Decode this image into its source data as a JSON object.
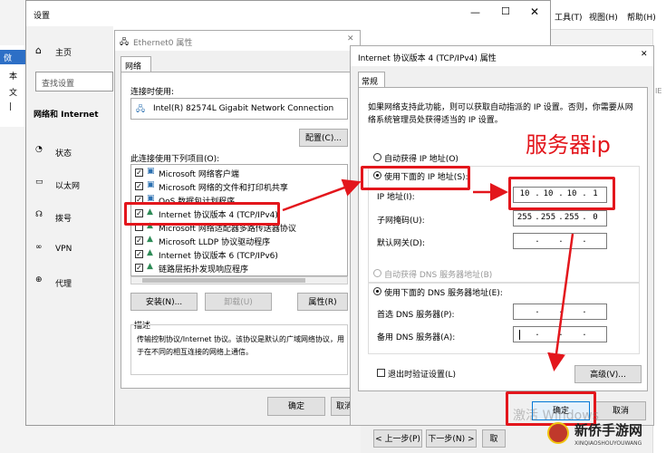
{
  "settings": {
    "title": "设置",
    "home": "主页",
    "search_placeholder": "查找设置",
    "section": "网络和 Internet",
    "items": [
      "状态",
      "以太网",
      "拨号",
      "VPN",
      "代理"
    ]
  },
  "explorer": {
    "menu_tools": "工具(T)",
    "menu_view": "视图(H)",
    "menu_help": "帮助(H)",
    "left_cut": "傚",
    "left_labels": [
      "本",
      "文",
      "|"
    ]
  },
  "eth": {
    "title": "Ethernet0 属性",
    "tab": "网络",
    "connect_using": "连接时使用:",
    "adapter": "Intel(R) 82574L Gigabit Network Connection",
    "config_button": "配置(C)...",
    "items_label": "此连接使用下列项目(O):",
    "items": [
      "Microsoft 网络客户端",
      "Microsoft 网络的文件和打印机共享",
      "QoS 数据包计划程序",
      "Internet 协议版本 4 (TCP/IPv4)",
      "Microsoft 网络适配器多路传送器协议",
      "Microsoft LLDP 协议驱动程序",
      "Internet 协议版本 6 (TCP/IPv6)",
      "链路层拓扑发现响应程序"
    ],
    "install": "安装(N)...",
    "uninstall": "卸载(U)",
    "properties": "属性(R)",
    "desc_label": "描述",
    "description_line1": "传输控制协议/Internet 协议。该协议是默认的广域网络协议，用",
    "description_line2": "于在不同的相互连接的网络上通信。",
    "ok": "确定",
    "cancel": "取消"
  },
  "ipv4": {
    "title": "Internet 协议版本 4 (TCP/IPv4) 属性",
    "tab": "常规",
    "info_line1": "如果网络支持此功能，则可以获取自动指派的 IP 设置。否则，你需要从网",
    "info_line2": "络系统管理员处获得适当的 IP 设置。",
    "auto_ip": "自动获得 IP 地址(O)",
    "manual_ip": "使用下面的 IP 地址(S):",
    "ip_label": "IP 地址(I):",
    "ip": [
      "10",
      "10",
      "10",
      "1"
    ],
    "mask_label": "子网掩码(U):",
    "mask": [
      "255",
      "255",
      "255",
      "0"
    ],
    "gw_label": "默认网关(D):",
    "auto_dns": "自动获得 DNS 服务器地址(B)",
    "manual_dns": "使用下面的 DNS 服务器地址(E):",
    "dns1_label": "首选 DNS 服务器(P):",
    "dns2_label": "备用 DNS 服务器(A):",
    "validate": "退出时验证设置(L)",
    "advanced": "高级(V)...",
    "ok": "确定",
    "cancel": "取消"
  },
  "bottom": {
    "prev": "< 上一步(P)",
    "next": "下一步(N) >",
    "cancel": "取"
  },
  "annotation": "服务器ip",
  "watermark": "激活 Windows",
  "logo_text": "新侨手游网",
  "logo_sub": "XINQIAOSHOUYOUWANG"
}
